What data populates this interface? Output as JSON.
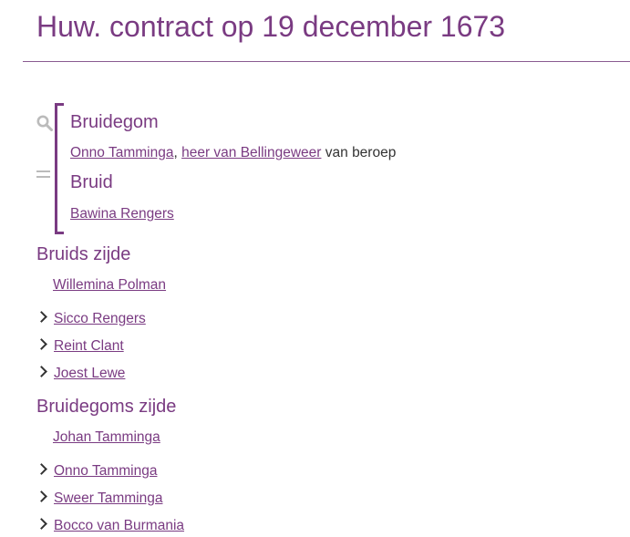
{
  "page": {
    "title": "Huw. contract op 19 december 1673"
  },
  "icons": {
    "search": "search-icon",
    "equals": "equals-icon",
    "expand": "chevron-right-icon"
  },
  "colors": {
    "accent": "#7a3b82",
    "text": "#333333",
    "icon_muted": "#bbbbbb"
  },
  "couple": {
    "groom_label": "Bruidegom",
    "groom_name": "Onno Tamminga",
    "groom_separator": ",",
    "groom_title": "heer van Bellingeweer",
    "groom_occupation_suffix": "van beroep",
    "bride_label": "Bruid",
    "bride_name": "Bawina Rengers"
  },
  "bride_side": {
    "heading": "Bruids zijde",
    "main": "Willemina Polman",
    "relatives": [
      "Sicco Rengers",
      "Reint Clant",
      "Joest Lewe"
    ]
  },
  "groom_side": {
    "heading": "Bruidegoms zijde",
    "main": "Johan Tamminga",
    "relatives": [
      "Onno Tamminga",
      "Sweer Tamminga",
      "Bocco van Burmania"
    ]
  }
}
